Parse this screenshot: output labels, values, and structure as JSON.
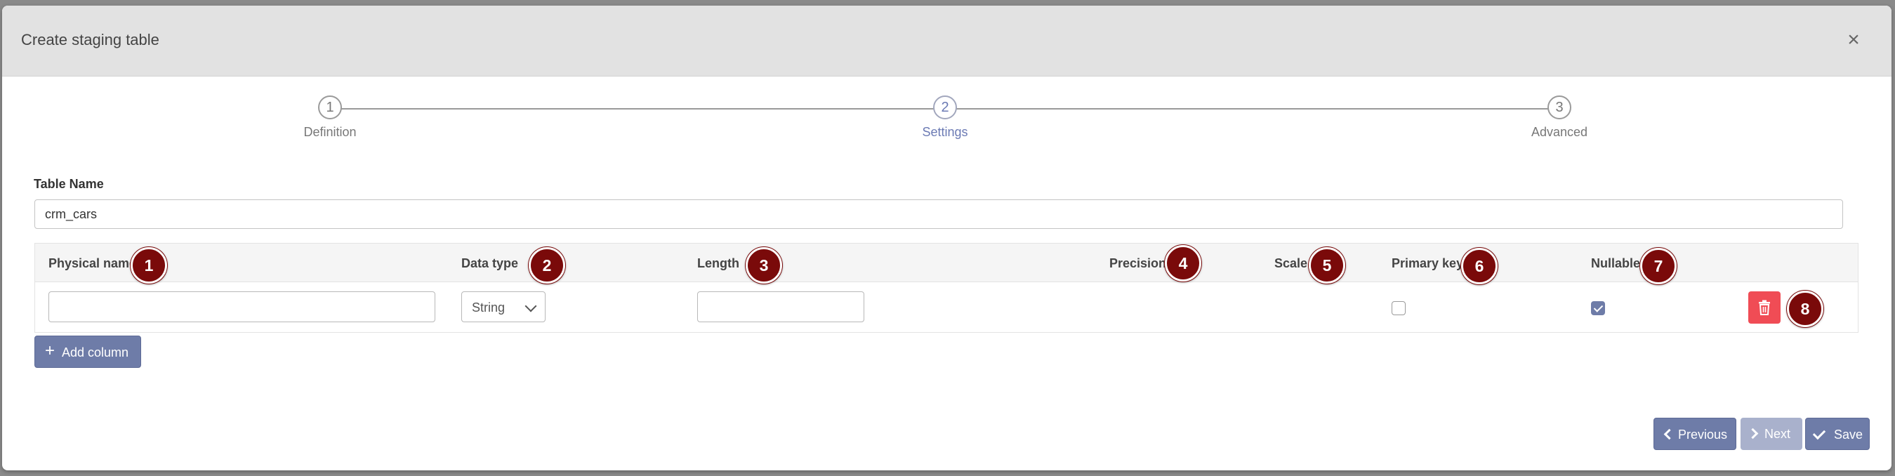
{
  "modal": {
    "title": "Create staging table",
    "close_icon": "close-icon"
  },
  "stepper": {
    "steps": [
      {
        "number": "1",
        "label": "Definition"
      },
      {
        "number": "2",
        "label": "Settings",
        "active": true
      },
      {
        "number": "3",
        "label": "Advanced"
      }
    ]
  },
  "form": {
    "table_name_label": "Table Name",
    "table_name_value": "crm_cars"
  },
  "columns_table": {
    "headers": [
      "Physical name",
      "Data type",
      "Length",
      "Precision",
      "Scale",
      "Primary key",
      "Nullable"
    ],
    "badges": [
      "1",
      "2",
      "3",
      "4",
      "5",
      "6",
      "7",
      "8"
    ],
    "rows": [
      {
        "physical_name": "",
        "data_type": "String",
        "length": "",
        "primary_key": false,
        "nullable": true
      }
    ]
  },
  "buttons": {
    "add_column": "Add column",
    "previous": "Previous",
    "next": "Next",
    "save": "Save"
  },
  "colors": {
    "accent": "#6e7ca8",
    "danger": "#f04c55",
    "badge": "#7a0a0a",
    "header_bg": "#e2e2e2"
  }
}
